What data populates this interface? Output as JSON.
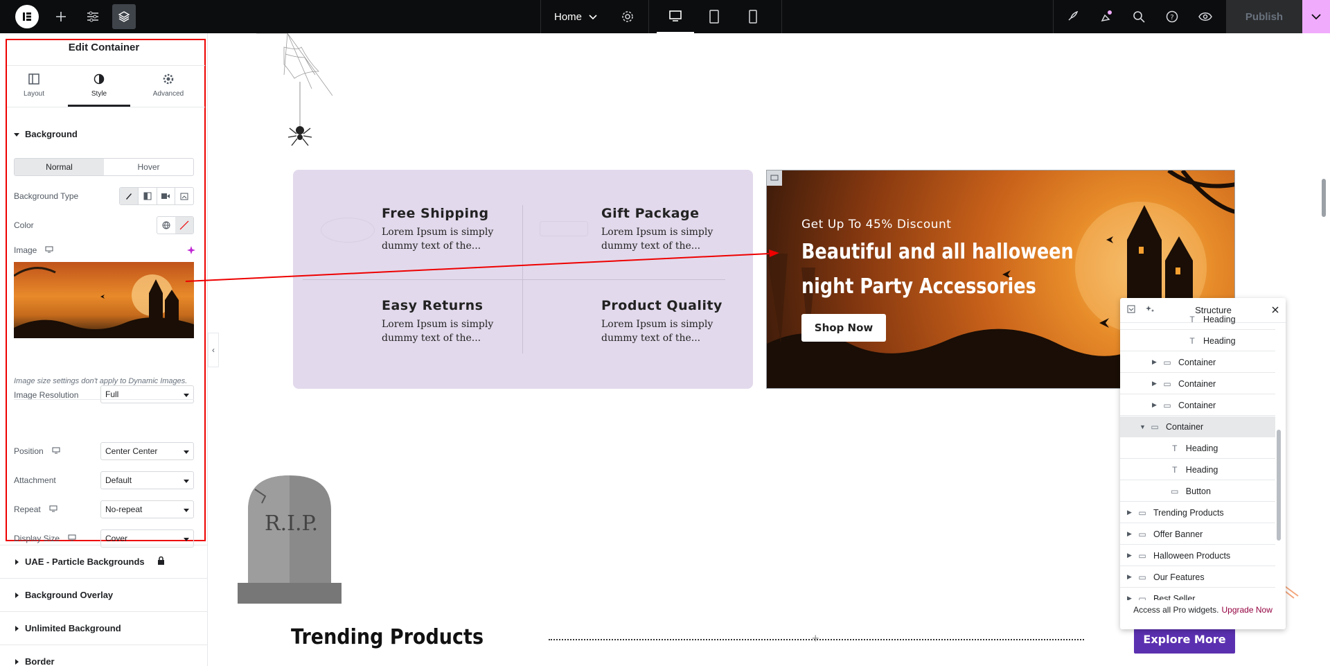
{
  "topbar": {
    "home_label": "Home",
    "publish_label": "Publish",
    "icons": [
      "elementor-logo-icon",
      "plus-icon",
      "sliders-icon",
      "layers-icon",
      "chevron-down-icon",
      "gear-icon",
      "desktop-icon",
      "tablet-icon",
      "mobile-icon",
      "rocket-icon",
      "notifications-icon",
      "search-icon",
      "help-icon",
      "eye-icon"
    ]
  },
  "panel": {
    "title": "Edit Container",
    "tabs": [
      {
        "label": "Layout"
      },
      {
        "label": "Style"
      },
      {
        "label": "Advanced"
      }
    ],
    "background_section": "Background",
    "state_tabs": [
      "Normal",
      "Hover"
    ],
    "background_type_label": "Background Type",
    "color_label": "Color",
    "image_label": "Image",
    "image_resolution_label": "Image Resolution",
    "image_resolution_value": "Full",
    "hint": "Image size settings don't apply to Dynamic Images.",
    "position_label": "Position",
    "position_value": "Center Center",
    "attachment_label": "Attachment",
    "attachment_value": "Default",
    "repeat_label": "Repeat",
    "repeat_value": "No-repeat",
    "display_size_label": "Display Size",
    "display_size_value": "Cover",
    "accordions": [
      "UAE - Particle Backgrounds",
      "Background Overlay",
      "Unlimited Background",
      "Border"
    ]
  },
  "canvas": {
    "features": [
      {
        "title": "Free Shipping",
        "desc1": "Lorem Ipsum is simply",
        "desc2": "dummy text of the..."
      },
      {
        "title": "Gift Package",
        "desc1": "Lorem Ipsum is simply",
        "desc2": "dummy text of the..."
      },
      {
        "title": "Easy Returns",
        "desc1": "Lorem Ipsum is simply",
        "desc2": "dummy text of the..."
      },
      {
        "title": "Product Quality",
        "desc1": "Lorem Ipsum is simply",
        "desc2": "dummy text of the..."
      }
    ],
    "banner": {
      "subtitle": "Get Up To 45% Discount",
      "title": "Beautiful and all halloween night Party Accessories",
      "button": "Shop Now"
    },
    "tombstone_text": "R.I.P.",
    "trending_title": "Trending Products",
    "explore_button": "Explore More"
  },
  "structure": {
    "title": "Structure",
    "rows": [
      {
        "label": "Heading",
        "indent": 2,
        "arrow": false,
        "icon": "T"
      },
      {
        "label": "Heading",
        "indent": 2,
        "arrow": false,
        "icon": "T"
      },
      {
        "label": "Container",
        "indent": 1,
        "arrow": true,
        "icon": "box"
      },
      {
        "label": "Container",
        "indent": 1,
        "arrow": true,
        "icon": "box"
      },
      {
        "label": "Container",
        "indent": 1,
        "arrow": true,
        "icon": "box"
      },
      {
        "label": "Container",
        "indent": 0.5,
        "arrow": "open",
        "icon": "box",
        "selected": true
      },
      {
        "label": "Heading",
        "indent": 1.3,
        "arrow": false,
        "icon": "T"
      },
      {
        "label": "Heading",
        "indent": 1.3,
        "arrow": false,
        "icon": "T"
      },
      {
        "label": "Button",
        "indent": 1.3,
        "arrow": false,
        "icon": "btn"
      },
      {
        "label": "Trending Products",
        "indent": 0,
        "arrow": true,
        "icon": "box"
      },
      {
        "label": "Offer Banner",
        "indent": 0,
        "arrow": true,
        "icon": "box"
      },
      {
        "label": "Halloween Products",
        "indent": 0,
        "arrow": true,
        "icon": "box"
      },
      {
        "label": "Our Features",
        "indent": 0,
        "arrow": true,
        "icon": "box"
      },
      {
        "label": "Best Seller",
        "indent": 0,
        "arrow": true,
        "icon": "box"
      }
    ],
    "footer_text": "Access all Pro widgets.",
    "footer_link": "Upgrade Now"
  }
}
